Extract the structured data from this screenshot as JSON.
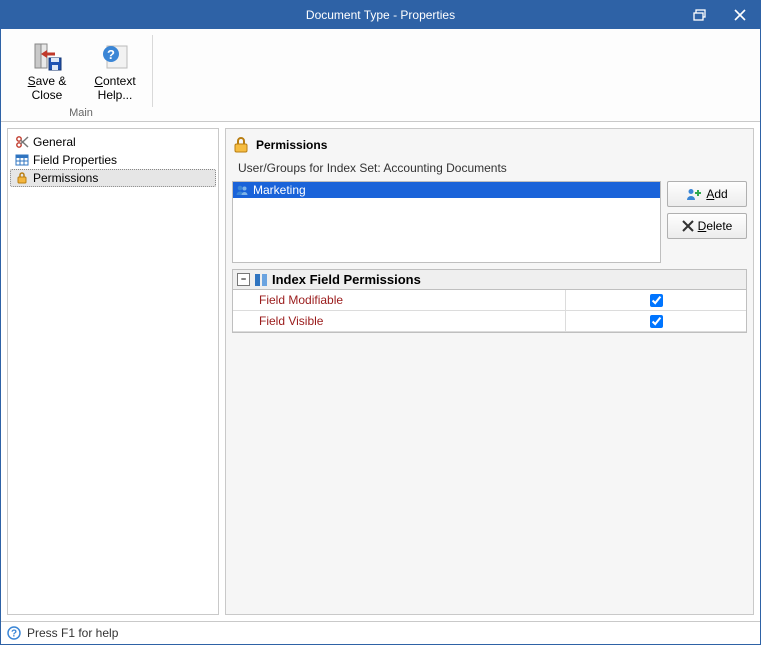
{
  "window": {
    "title": "Document Type - Properties"
  },
  "ribbon": {
    "group_main_caption": "Main",
    "save_close": {
      "label_line1": "Save &",
      "label_line2": "Close",
      "underline_index": 0
    },
    "context_help": {
      "label_line1": "Context",
      "label_line2": "Help...",
      "underline_index": 0
    }
  },
  "nav": {
    "items": [
      {
        "label": "General",
        "icon": "scissors"
      },
      {
        "label": "Field Properties",
        "icon": "grid"
      },
      {
        "label": "Permissions",
        "icon": "lock"
      }
    ],
    "selected_index": 2
  },
  "permissions": {
    "section_title": "Permissions",
    "usergroups_prefix": "User/Groups for Index Set: ",
    "index_set_name": "Accounting Documents",
    "entries": [
      {
        "name": "Marketing",
        "selected": true
      }
    ],
    "add_label": "Add",
    "delete_label": "Delete"
  },
  "grid": {
    "header": "Index Field Permissions",
    "rows": [
      {
        "label": "Field Modifiable",
        "checked": true
      },
      {
        "label": "Field Visible",
        "checked": true
      }
    ]
  },
  "status": {
    "text": "Press F1 for help"
  }
}
